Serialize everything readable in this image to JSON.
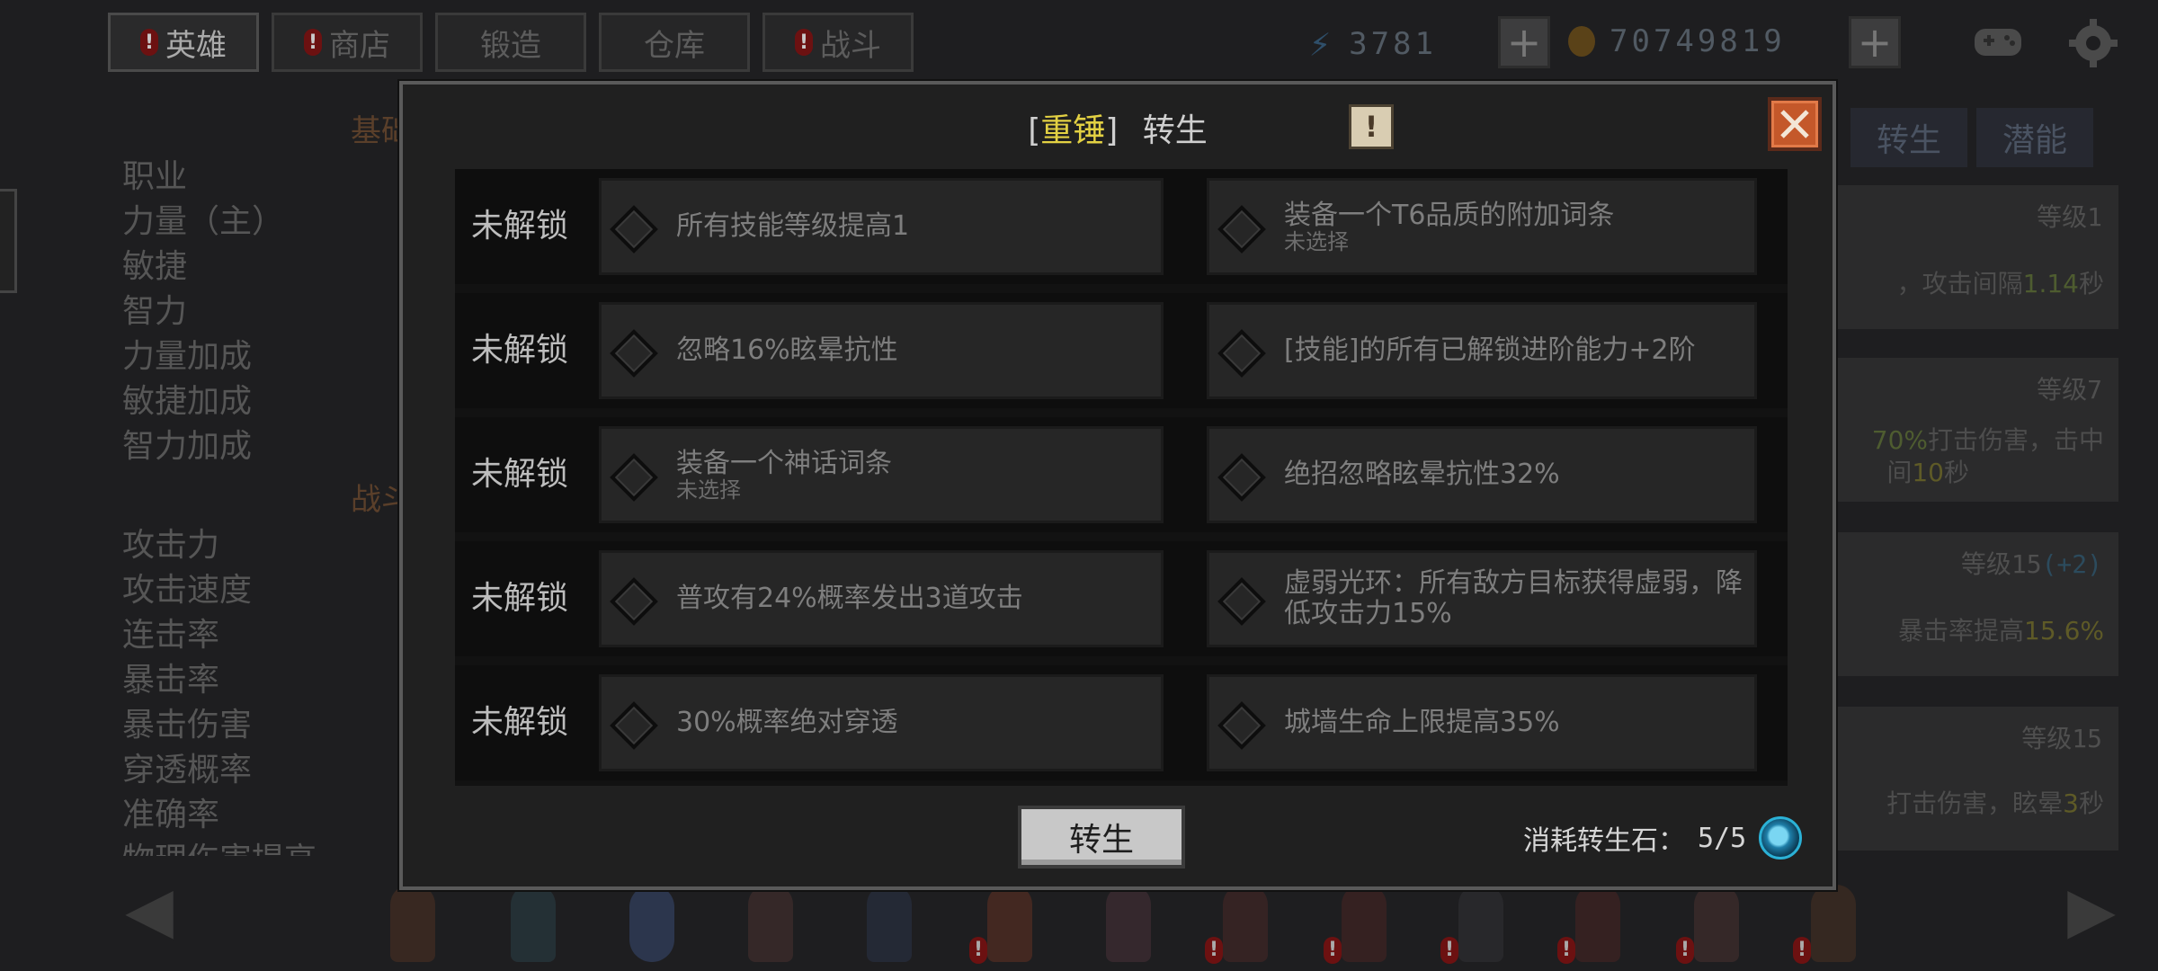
{
  "topbar": {
    "tabs": [
      {
        "label": "英雄",
        "alert": true,
        "active": true
      },
      {
        "label": "商店",
        "alert": true,
        "active": false
      },
      {
        "label": "锻造",
        "alert": false,
        "active": false
      },
      {
        "label": "仓库",
        "alert": false,
        "active": false
      },
      {
        "label": "战斗",
        "alert": true,
        "active": false
      }
    ],
    "alert_mark": "!",
    "energy": "3781",
    "gold": "70749819",
    "plus": "+"
  },
  "left_panel": {
    "section_basic": "基础",
    "basic_stats": [
      "职业",
      "力量（主）",
      "敏捷",
      "智力",
      "力量加成",
      "敏捷加成",
      "智力加成"
    ],
    "section_combat": "战斗",
    "combat_stats": [
      "攻击力",
      "攻击速度",
      "连击率",
      "暴击率",
      "暴击伤害",
      "穿透概率",
      "准确率",
      "物理伤害提高"
    ]
  },
  "right_panel": {
    "tabs": [
      "转生",
      "潜能"
    ],
    "cards": [
      {
        "level": "等级1",
        "desc_prefix": "，攻击间隔",
        "desc_value": "1.14",
        "desc_suffix": "秒"
      },
      {
        "level": "等级7",
        "line1_value": "70%",
        "line1_suffix": "打击伤害，击中",
        "line2_prefix": "间",
        "line2_value": "10",
        "line2_suffix": "秒"
      },
      {
        "level": "等级15",
        "level_bonus": "(+2)",
        "desc_prefix": "暴击率提高",
        "desc_value": "15.6%"
      },
      {
        "level": "等级15",
        "desc_prefix": "打击伤害，眩晕",
        "desc_value": "3",
        "desc_suffix": "秒"
      }
    ]
  },
  "modal": {
    "title_open": "[",
    "title_name": "重锤",
    "title_close": "]",
    "title_text": "转生",
    "info_mark": "!",
    "rows": [
      {
        "lock": "未解锁",
        "a": {
          "text": "所有技能等级提高1",
          "sub": ""
        },
        "b": {
          "text": "装备一个T6品质的附加词条",
          "sub": "未选择"
        }
      },
      {
        "lock": "未解锁",
        "a": {
          "text": "忽略16%眩晕抗性",
          "sub": ""
        },
        "b": {
          "text": "[技能]的所有已解锁进阶能力+2阶",
          "sub": ""
        }
      },
      {
        "lock": "未解锁",
        "a": {
          "text": "装备一个神话词条",
          "sub": "未选择"
        },
        "b": {
          "text": "绝招忽略眩晕抗性32%",
          "sub": ""
        }
      },
      {
        "lock": "未解锁",
        "a": {
          "text": "普攻有24%概率发出3道攻击",
          "sub": ""
        },
        "b": {
          "text": "虚弱光环：所有敌方目标获得虚弱，降低攻击力15%",
          "sub": ""
        }
      },
      {
        "lock": "未解锁",
        "a": {
          "text": "30%概率绝对穿透",
          "sub": ""
        },
        "b": {
          "text": "城墙生命上限提高35%",
          "sub": ""
        }
      }
    ],
    "rebirth_button": "转生",
    "cost_label": "消耗转生石：",
    "cost_value": "5/5"
  },
  "colors": {
    "title_name": "#e3d143",
    "close_button": "#c4582a",
    "alert_badge": "#6c1111"
  }
}
